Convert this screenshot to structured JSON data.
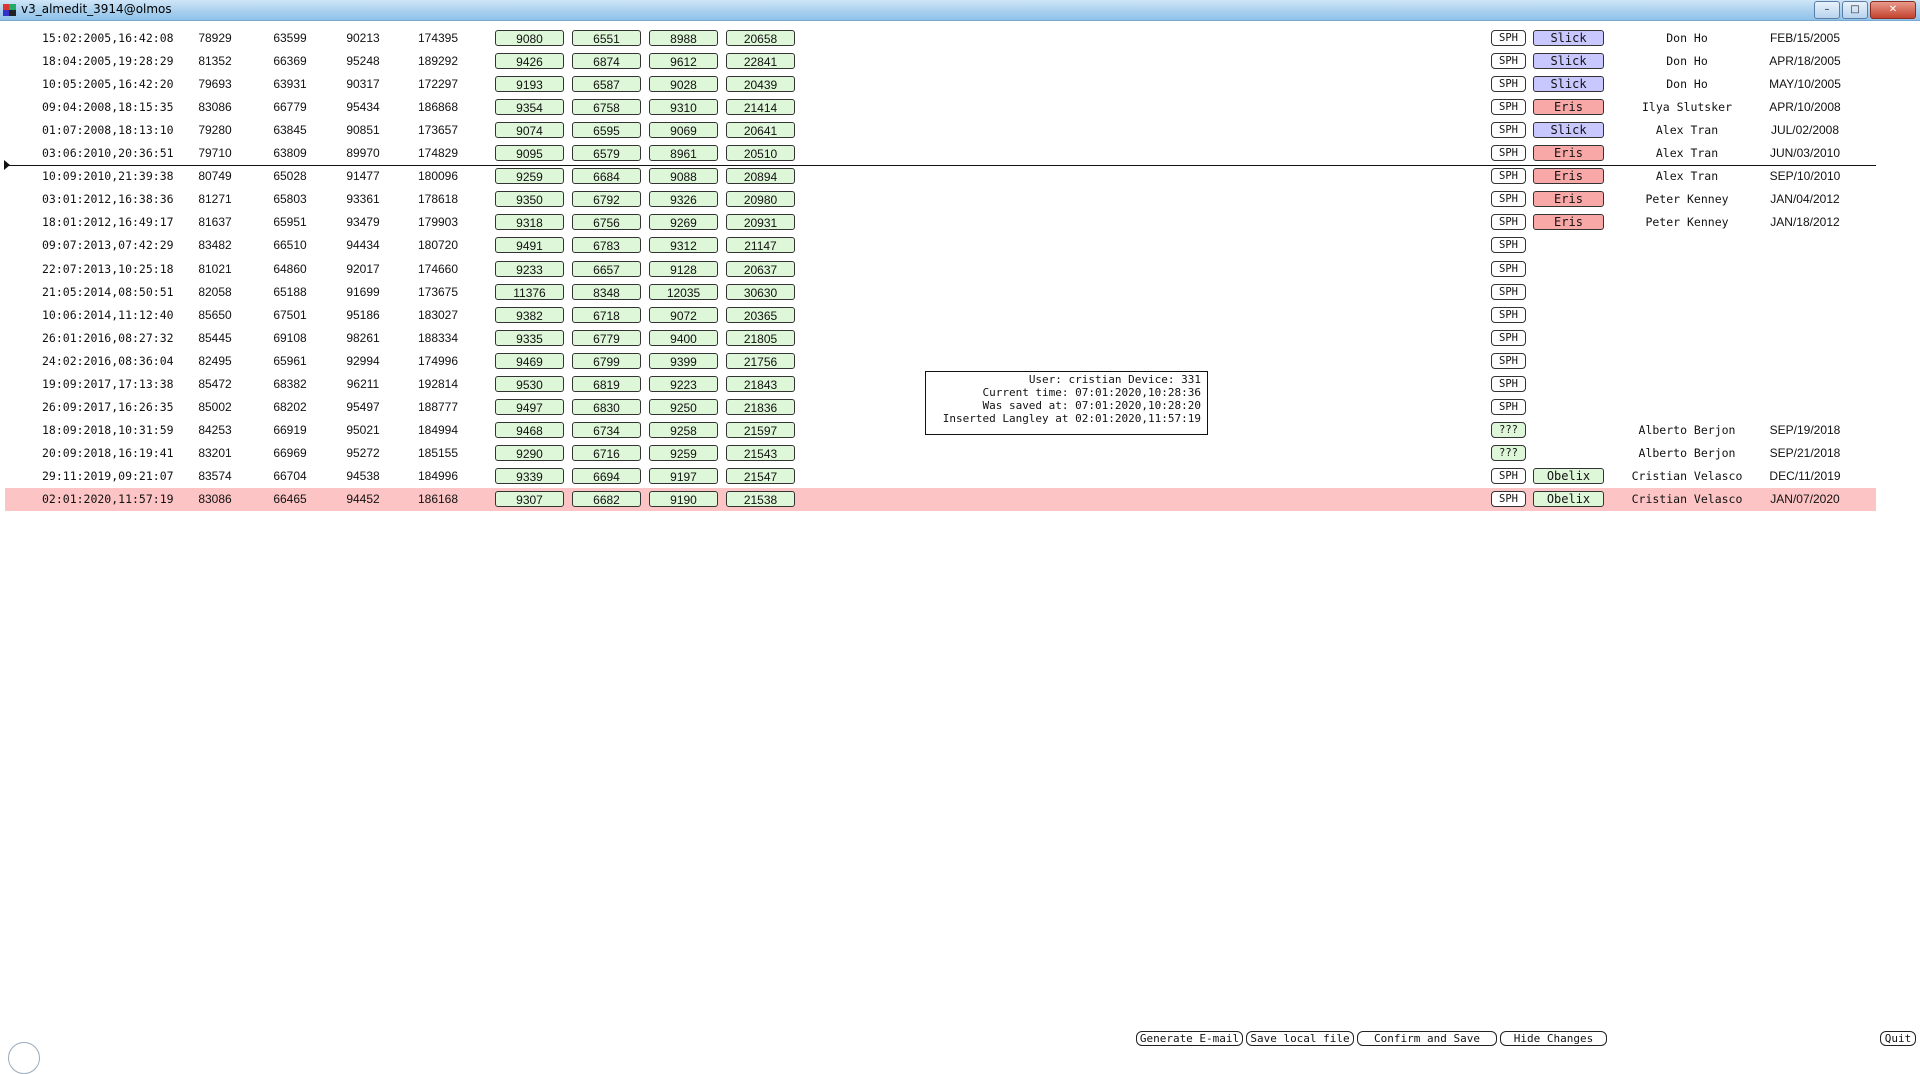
{
  "window": {
    "title": "v3_almedit_3914@olmos",
    "icon": "app-icon",
    "controls": {
      "minimize": "–",
      "maximize": "□",
      "close": "✕"
    }
  },
  "rows": [
    {
      "date": "15:02:2005,16:42:08",
      "n1": "78929",
      "n2": "63599",
      "n3": "90213",
      "n4": "174395",
      "g1": "9080",
      "g2": "6551",
      "g3": "8988",
      "g4": "20658",
      "sph": "SPH",
      "tag": "Slick",
      "who": "Don Ho",
      "when": "FEB/15/2005"
    },
    {
      "date": "18:04:2005,19:28:29",
      "n1": "81352",
      "n2": "66369",
      "n3": "95248",
      "n4": "189292",
      "g1": "9426",
      "g2": "6874",
      "g3": "9612",
      "g4": "22841",
      "sph": "SPH",
      "tag": "Slick",
      "who": "Don Ho",
      "when": "APR/18/2005"
    },
    {
      "date": "10:05:2005,16:42:20",
      "n1": "79693",
      "n2": "63931",
      "n3": "90317",
      "n4": "172297",
      "g1": "9193",
      "g2": "6587",
      "g3": "9028",
      "g4": "20439",
      "sph": "SPH",
      "tag": "Slick",
      "who": "Don Ho",
      "when": "MAY/10/2005"
    },
    {
      "date": "09:04:2008,18:15:35",
      "n1": "83086",
      "n2": "66779",
      "n3": "95434",
      "n4": "186868",
      "g1": "9354",
      "g2": "6758",
      "g3": "9310",
      "g4": "21414",
      "sph": "SPH",
      "tag": "Eris",
      "who": "Ilya Slutsker",
      "when": "APR/10/2008"
    },
    {
      "date": "01:07:2008,18:13:10",
      "n1": "79280",
      "n2": "63845",
      "n3": "90851",
      "n4": "173657",
      "g1": "9074",
      "g2": "6595",
      "g3": "9069",
      "g4": "20641",
      "sph": "SPH",
      "tag": "Slick",
      "who": "Alex Tran",
      "when": "JUL/02/2008"
    },
    {
      "date": "03:06:2010,20:36:51",
      "n1": "79710",
      "n2": "63809",
      "n3": "89970",
      "n4": "174829",
      "g1": "9095",
      "g2": "6579",
      "g3": "8961",
      "g4": "20510",
      "sph": "SPH",
      "tag": "Eris",
      "who": "Alex Tran",
      "when": "JUN/03/2010"
    },
    {
      "date": "10:09:2010,21:39:38",
      "n1": "80749",
      "n2": "65028",
      "n3": "91477",
      "n4": "180096",
      "g1": "9259",
      "g2": "6684",
      "g3": "9088",
      "g4": "20894",
      "sph": "SPH",
      "tag": "Eris",
      "who": "Alex Tran",
      "when": "SEP/10/2010"
    },
    {
      "date": "03:01:2012,16:38:36",
      "n1": "81271",
      "n2": "65803",
      "n3": "93361",
      "n4": "178618",
      "g1": "9350",
      "g2": "6792",
      "g3": "9326",
      "g4": "20980",
      "sph": "SPH",
      "tag": "Eris",
      "who": "Peter Kenney",
      "when": "JAN/04/2012"
    },
    {
      "date": "18:01:2012,16:49:17",
      "n1": "81637",
      "n2": "65951",
      "n3": "93479",
      "n4": "179903",
      "g1": "9318",
      "g2": "6756",
      "g3": "9269",
      "g4": "20931",
      "sph": "SPH",
      "tag": "Eris",
      "who": "Peter Kenney",
      "when": "JAN/18/2012"
    },
    {
      "date": "09:07:2013,07:42:29",
      "n1": "83482",
      "n2": "66510",
      "n3": "94434",
      "n4": "180720",
      "g1": "9491",
      "g2": "6783",
      "g3": "9312",
      "g4": "21147",
      "sph": "SPH",
      "tag": "",
      "who": "",
      "when": ""
    },
    {
      "date": "22:07:2013,10:25:18",
      "n1": "81021",
      "n2": "64860",
      "n3": "92017",
      "n4": "174660",
      "g1": "9233",
      "g2": "6657",
      "g3": "9128",
      "g4": "20637",
      "sph": "SPH",
      "tag": "",
      "who": "",
      "when": ""
    },
    {
      "date": "21:05:2014,08:50:51",
      "n1": "82058",
      "n2": "65188",
      "n3": "91699",
      "n4": "173675",
      "g1": "11376",
      "g2": "8348",
      "g3": "12035",
      "g4": "30630",
      "sph": "SPH",
      "tag": "",
      "who": "",
      "when": ""
    },
    {
      "date": "10:06:2014,11:12:40",
      "n1": "85650",
      "n2": "67501",
      "n3": "95186",
      "n4": "183027",
      "g1": "9382",
      "g2": "6718",
      "g3": "9072",
      "g4": "20365",
      "sph": "SPH",
      "tag": "",
      "who": "",
      "when": ""
    },
    {
      "date": "26:01:2016,08:27:32",
      "n1": "85445",
      "n2": "69108",
      "n3": "98261",
      "n4": "188334",
      "g1": "9335",
      "g2": "6779",
      "g3": "9400",
      "g4": "21805",
      "sph": "SPH",
      "tag": "",
      "who": "",
      "when": ""
    },
    {
      "date": "24:02:2016,08:36:04",
      "n1": "82495",
      "n2": "65961",
      "n3": "92994",
      "n4": "174996",
      "g1": "9469",
      "g2": "6799",
      "g3": "9399",
      "g4": "21756",
      "sph": "SPH",
      "tag": "",
      "who": "",
      "when": ""
    },
    {
      "date": "19:09:2017,17:13:38",
      "n1": "85472",
      "n2": "68382",
      "n3": "96211",
      "n4": "192814",
      "g1": "9530",
      "g2": "6819",
      "g3": "9223",
      "g4": "21843",
      "sph": "SPH",
      "tag": "",
      "who": "",
      "when": ""
    },
    {
      "date": "26:09:2017,16:26:35",
      "n1": "85002",
      "n2": "68202",
      "n3": "95497",
      "n4": "188777",
      "g1": "9497",
      "g2": "6830",
      "g3": "9250",
      "g4": "21836",
      "sph": "SPH",
      "tag": "",
      "who": "",
      "when": ""
    },
    {
      "date": "18:09:2018,10:31:59",
      "n1": "84253",
      "n2": "66919",
      "n3": "95021",
      "n4": "184994",
      "g1": "9468",
      "g2": "6734",
      "g3": "9258",
      "g4": "21597",
      "sph": "???",
      "tag": "",
      "who": "Alberto Berjon",
      "when": "SEP/19/2018"
    },
    {
      "date": "20:09:2018,16:19:41",
      "n1": "83201",
      "n2": "66969",
      "n3": "95272",
      "n4": "185155",
      "g1": "9290",
      "g2": "6716",
      "g3": "9259",
      "g4": "21543",
      "sph": "???",
      "tag": "",
      "who": "Alberto Berjon",
      "when": "SEP/21/2018"
    },
    {
      "date": "29:11:2019,09:21:07",
      "n1": "83574",
      "n2": "66704",
      "n3": "94538",
      "n4": "184996",
      "g1": "9339",
      "g2": "6694",
      "g3": "9197",
      "g4": "21547",
      "sph": "SPH",
      "tag": "Obelix",
      "who": "Cristian Velasco",
      "when": "DEC/11/2019"
    },
    {
      "date": "02:01:2020,11:57:19",
      "n1": "83086",
      "n2": "66465",
      "n3": "94452",
      "n4": "186168",
      "g1": "9307",
      "g2": "6682",
      "g3": "9190",
      "g4": "21538",
      "sph": "SPH",
      "tag": "Obelix",
      "who": "Cristian Velasco",
      "when": "JAN/07/2020",
      "highlight": true
    }
  ],
  "info": {
    "line1": "User: cristian Device: 331",
    "line2": "Current time: 07:01:2020,10:28:36",
    "line3": "Was saved at: 07:01:2020,10:28:20",
    "line4": "Inserted Langley at 02:01:2020,11:57:19"
  },
  "buttons": {
    "generate_email": "Generate E-mail",
    "save_local": "Save local file",
    "confirm_save": "Confirm and Save",
    "hide_changes": "Hide Changes",
    "quit": "Quit"
  },
  "colors": {
    "highlight_row": "#fcc4c4",
    "green_cell": "#dff7d9",
    "slick": "#c8c8ff",
    "eris": "#f9a8a8",
    "obelix": "#dff7d9"
  }
}
